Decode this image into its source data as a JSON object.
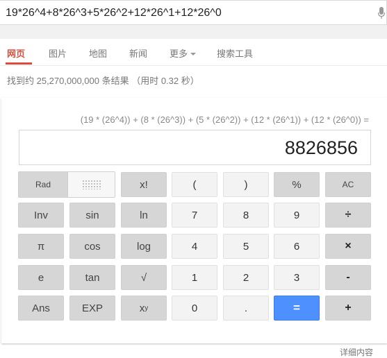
{
  "search": {
    "query": "19*26^4+8*26^3+5*26^2+12*26^1+12*26^0"
  },
  "tabs": [
    {
      "label": "网页",
      "active": true
    },
    {
      "label": "图片",
      "active": false
    },
    {
      "label": "地图",
      "active": false
    },
    {
      "label": "新闻",
      "active": false
    },
    {
      "label": "更多",
      "active": false,
      "has_dropdown": true
    },
    {
      "label": "搜索工具",
      "active": false
    }
  ],
  "result_stats": "找到约 25,270,000,000 条结果 （用时 0.32 秒）",
  "calculator": {
    "expression": "(19 * (26^4)) + (8 * (26^3)) + (5 * (26^2)) + (12 * (26^1)) + (12 * (26^0)) =",
    "result": "8826856",
    "mode_label": "Rad",
    "keys": {
      "factorial": "x!",
      "open_paren": "(",
      "close_paren": ")",
      "percent": "%",
      "clear": "AC",
      "inv": "Inv",
      "sin": "sin",
      "ln": "ln",
      "seven": "7",
      "eight": "8",
      "nine": "9",
      "divide": "÷",
      "pi": "π",
      "cos": "cos",
      "log": "log",
      "four": "4",
      "five": "5",
      "six": "6",
      "multiply": "×",
      "e": "e",
      "tan": "tan",
      "sqrt": "√",
      "one": "1",
      "two": "2",
      "three": "3",
      "minus": "-",
      "ans": "Ans",
      "exp": "EXP",
      "power_base": "x",
      "power_exp": "y",
      "zero": "0",
      "dot": ".",
      "equals": "=",
      "plus": "+"
    },
    "colors": {
      "equals_key": "#4d90fe",
      "active_tab": "#dd4b39"
    }
  },
  "details_link": "详细内容"
}
